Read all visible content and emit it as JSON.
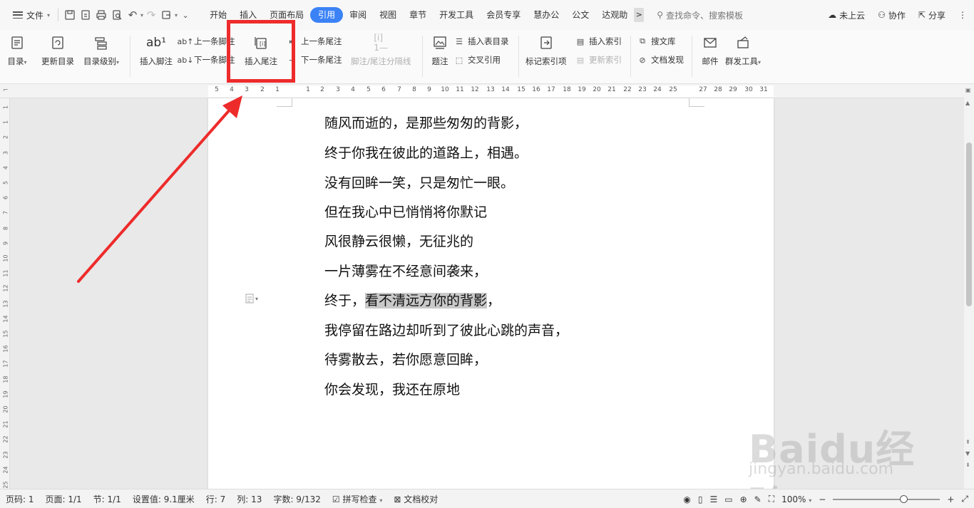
{
  "menubar": {
    "file_label": "文件",
    "tabs": [
      "开始",
      "插入",
      "页面布局",
      "引用",
      "审阅",
      "视图",
      "章节",
      "开发工具",
      "会员专享",
      "慧办公",
      "公文",
      "达观助"
    ],
    "active_tab": "引用",
    "more_label": ">",
    "search_placeholder": "查找命令、搜索模板",
    "cloud_label": "未上云",
    "collab_label": "协作",
    "share_label": "分享"
  },
  "ribbon": {
    "toc_label": "目录",
    "update_toc_label": "更新目录",
    "toc_level_label": "目录级别",
    "insert_footnote_label": "插入脚注",
    "prev_footnote_label": "上一条脚注",
    "next_footnote_label": "下一条脚注",
    "insert_endnote_label": "插入尾注",
    "prev_endnote_label": "上一条尾注",
    "next_endnote_label": "下一条尾注",
    "separator_label": "脚注/尾注分隔线",
    "caption_label": "题注",
    "insert_table_toc_label": "插入表目录",
    "cross_ref_label": "交叉引用",
    "mark_index_label": "标记索引项",
    "insert_index_label": "插入索引",
    "update_index_label": "更新索引",
    "search_lib_label": "搜文库",
    "doc_discover_label": "文档发现",
    "mail_label": "邮件",
    "mass_tool_label": "群发工具"
  },
  "ruler": {
    "ticks": [
      "5",
      "4",
      "3",
      "2",
      "1",
      "1",
      "2",
      "3",
      "4",
      "5",
      "6",
      "7",
      "8",
      "9",
      "10",
      "11",
      "12",
      "13",
      "14",
      "15",
      "16",
      "17",
      "18",
      "19",
      "20",
      "21",
      "22",
      "23",
      "24",
      "25",
      "27",
      "28",
      "29",
      "30",
      "31"
    ],
    "vticks": [
      "1",
      "1",
      "2",
      "3",
      "4",
      "5",
      "6",
      "7",
      "8",
      "9",
      "10",
      "11",
      "12",
      "13",
      "14",
      "15",
      "16",
      "17",
      "18",
      "19",
      "20",
      "21",
      "22",
      "23",
      "24",
      "25"
    ]
  },
  "document": {
    "lines": [
      "随风而逝的，是那些匆匆的背影，",
      "终于你我在彼此的道路上，相遇。",
      "没有回眸一笑，只是匆忙一眼。",
      "但在我心中已悄悄将你默记",
      "风很静云很懒，无征兆的",
      "一片薄雾在不经意间袭来，"
    ],
    "line7_prefix": "终于，",
    "line7_selected": "看不清远方你的背影",
    "line7_suffix": "，",
    "lines_after": [
      "我停留在路边却听到了彼此心跳的声音，",
      "待雾散去，若你愿意回眸，",
      "你会发现，我还在原地"
    ]
  },
  "statusbar": {
    "page_num": "页码: 1",
    "page": "页面: 1/1",
    "section": "节: 1/1",
    "setting": "设置值: 9.1厘米",
    "row": "行: 7",
    "col": "列: 13",
    "words": "字数: 9/132",
    "spell_check": "拼写检查",
    "doc_proof": "文档校对",
    "zoom": "100%"
  },
  "watermark": {
    "main": "Baidu经验",
    "sub": "jingyan.baidu.com"
  },
  "colors": {
    "accent": "#3b82f6",
    "highlight_red": "#ee2b2b",
    "selection": "#c9c9c9"
  }
}
